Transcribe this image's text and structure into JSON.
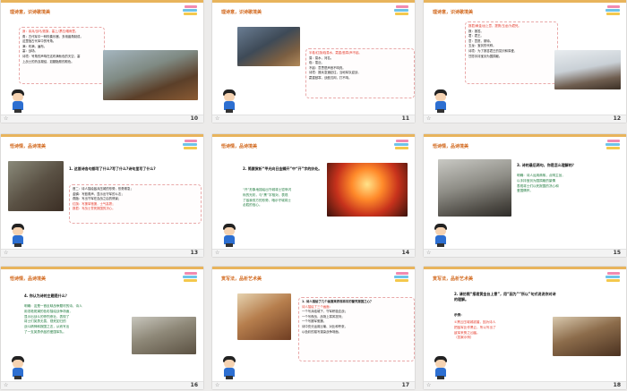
{
  "slides": [
    {
      "number": "10",
      "section_title": "理诗意，识诗歌境美",
      "lines": [
        "身：亲兵/战马/旌旗，塞上/漂泊/烟雨里。",
        "角：古代军中一种吹奏乐器，多用兽角制成，",
        "这里指古代军中的号角。",
        "满：布满，遍布。",
        "塞：战场。",
        "诗境：号角的声响在这布满秋色的天空，塞",
        "上战士的热血凝结，如胭脂般的颜色。"
      ]
    },
    {
      "number": "11",
      "section_title": "理诗意，识诗歌境美",
      "lines": [
        "半卷/红旗/临易水，霜重/鼓寒/声不起。",
        "易：易水，河名。",
        "临：靠近。",
        "不起：意思是声音不响亮。",
        "诗境：援兵急速赶往，当地军队迎战，",
        "霜重鼓寒，战鼓沉闷，打不响。"
      ]
    },
    {
      "number": "12",
      "section_title": "理诗意，识诗歌境美",
      "lines": [
        "报君/黄金/台上意，提携/玉龙/为君死。",
        "报：报答。",
        "君：君王。",
        "意：意愿，期待。",
        "玉龙：宝剑的代称。",
        "诗境：为了报答君王的赏识和厚爱，",
        "甘愿手持宝剑为国捐躯。"
      ]
    },
    {
      "number": "13",
      "section_title": "悟诗情，品诗境美",
      "question": "1. 这首诗各句都写了什么?写了什么?诗句里写了什么?",
      "lines": [
        "首二：诗人描绘敌兵压城的形势，形势紧急；",
        "金鳞：写鼓角声，显示出守军的斗志；",
        "燕脂：写出守军在血战之后的情景；",
        "红旗：写援军驰援，士气高昂；",
        "报君：写战士誓死报国的决心。"
      ]
    },
    {
      "number": "14",
      "section_title": "悟诗情，品诗境美",
      "question": "2. 简要赏析“甲光向日金鳞开”中“开”字的妙处。",
      "lines": [
        "“开”形象地描绘出守城将士铠甲闪",
        "烁的光彩，与“黑”字相对，表现",
        "了敌我双方的形势，暗示守城将士",
        "必胜的信心。"
      ]
    },
    {
      "number": "15",
      "section_title": "悟诗情，品诗境美",
      "question": "3. 诗的最后两句，你是怎么理解的？",
      "lines": [
        "明确：诗人运用典故，点明主旨，",
        "以手持宝剑为国捐躯的豪情",
        "表现将士们以死报国的决心和",
        "爱国情怀。"
      ]
    },
    {
      "number": "16",
      "section_title": "悟诗情，品诗境美",
      "question": "4. 你认为诗的主题是什么？",
      "lines": [
        "明确：这是一首反映战争题材的诗，诗人",
        "用浓艳斑斓的色彩描绘战争场面，",
        "显示出战斗的惨烈悲壮，表现了",
        "将士们英勇无畏、视死如归的",
        "战斗精神和报国之志，从而写出",
        "了一支英勇杀敌的爱国军队。"
      ]
    },
    {
      "number": "17",
      "section_title": "赏写法，品析艺术美",
      "question": "1. 诗人描绘了几个画面来表现将军的誓死报国之心？",
      "lines": [
        "诗人描绘了三个画面：",
        "一个写兵临城下，守军积极应战；",
        "一个写夜战，战场上寒风凛冽；",
        "一个写援军驰援。",
        "诗中充分运用比喻、对比和夸张，",
        "以色彩的描写渲染战争场面。"
      ]
    },
    {
      "number": "18",
      "section_title": "赏写法，品析艺术美",
      "question": "2. 请仿照“报君黄金台上意”，用“因为”“所以”句式说说你对诗的理解。",
      "example_label": "示例：",
      "lines": [
        "①黑云压城城欲摧，因为诗人",
        "把敌军比作黑云，所以写出了",
        "敌军来势之凶猛。",
        "（答案示例）"
      ]
    }
  ]
}
